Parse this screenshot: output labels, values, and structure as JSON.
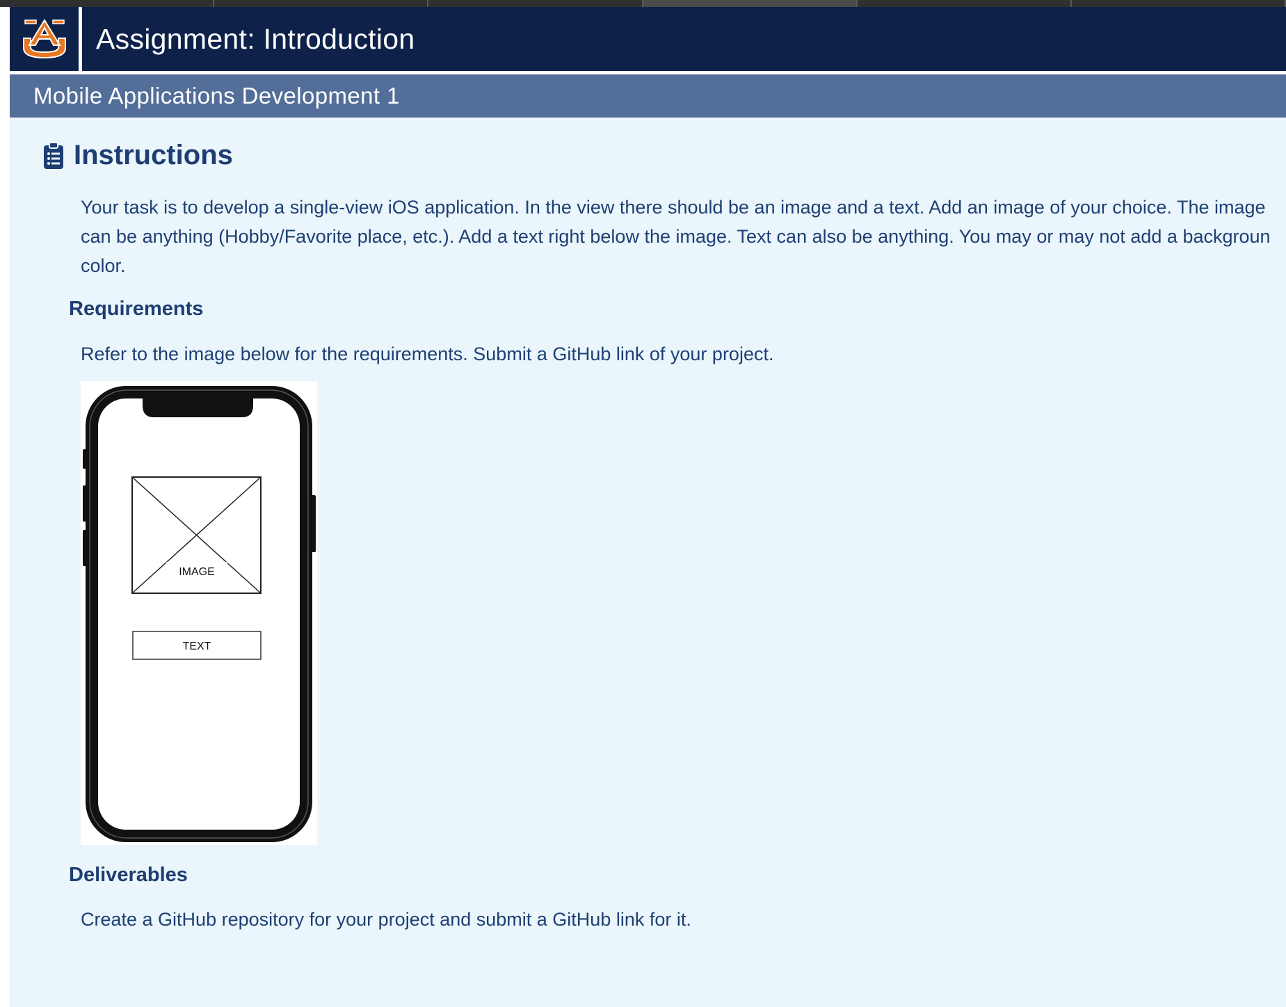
{
  "header": {
    "logo_alt": "AU",
    "title": "Assignment: Introduction"
  },
  "subheader": {
    "course": "Mobile Applications Development 1"
  },
  "instructions": {
    "title": "Instructions",
    "icon": "clipboard-list-icon",
    "body_lines": [
      "Your task is to develop a single-view iOS application. In the view there should be an image and a text. Add an image of your choice. The image",
      "can be anything (Hobby/Favorite place, etc.). Add a text right below the image. Text can also be anything. You may or may not add a backgroun",
      "color."
    ]
  },
  "requirements": {
    "title": "Requirements",
    "body": "Refer to the image below for the requirements. Submit a GitHub link of your project.",
    "mockup": {
      "image_label": "IMAGE",
      "text_label": "TEXT"
    }
  },
  "deliverables": {
    "title": "Deliverables",
    "body": "Create a GitHub repository for your project and submit a GitHub link for it."
  },
  "colors": {
    "header_bg": "#0e2149",
    "subheader_bg": "#536e98",
    "content_bg": "#eaf6fc",
    "text": "#1f3f73",
    "logo_orange": "#e87722"
  }
}
